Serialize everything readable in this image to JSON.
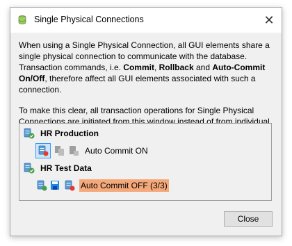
{
  "window": {
    "title": "Single Physical Connections",
    "close_glyph": "✕"
  },
  "description": {
    "p1_pre": "When using a Single Physical Connection, all GUI elements share a single physical connection to communicate with the database. Transaction commands, i.e. ",
    "commit": "Commit",
    "sep1": ", ",
    "rollback": "Rollback",
    "sep2": " and ",
    "autocommit": "Auto-Commit On/Off",
    "p1_post": ", therefore affect all GUI elements associated with such a connection.",
    "p2": "To make this clear, all transaction operations for Single Physical Connections are initiated from this window instead of from individual SQL Commander tabs."
  },
  "connections": [
    {
      "name": "HR Production",
      "icon": "database-connection-icon",
      "actions": [
        "commit-icon",
        "rollback-icon",
        "autocommit-toggle-icon"
      ],
      "status": "Auto Commit ON",
      "highlight": false
    },
    {
      "name": "HR Test Data",
      "icon": "database-connection-icon",
      "actions": [
        "commit-icon",
        "rollback-icon",
        "autocommit-toggle-icon"
      ],
      "status": "Auto Commit OFF (3/3)",
      "highlight": true
    }
  ],
  "buttons": {
    "close": "Close"
  },
  "colors": {
    "highlight": "#f5a97a",
    "selection_border": "#3399ff",
    "dialog_bg": "#f0f0f0"
  }
}
